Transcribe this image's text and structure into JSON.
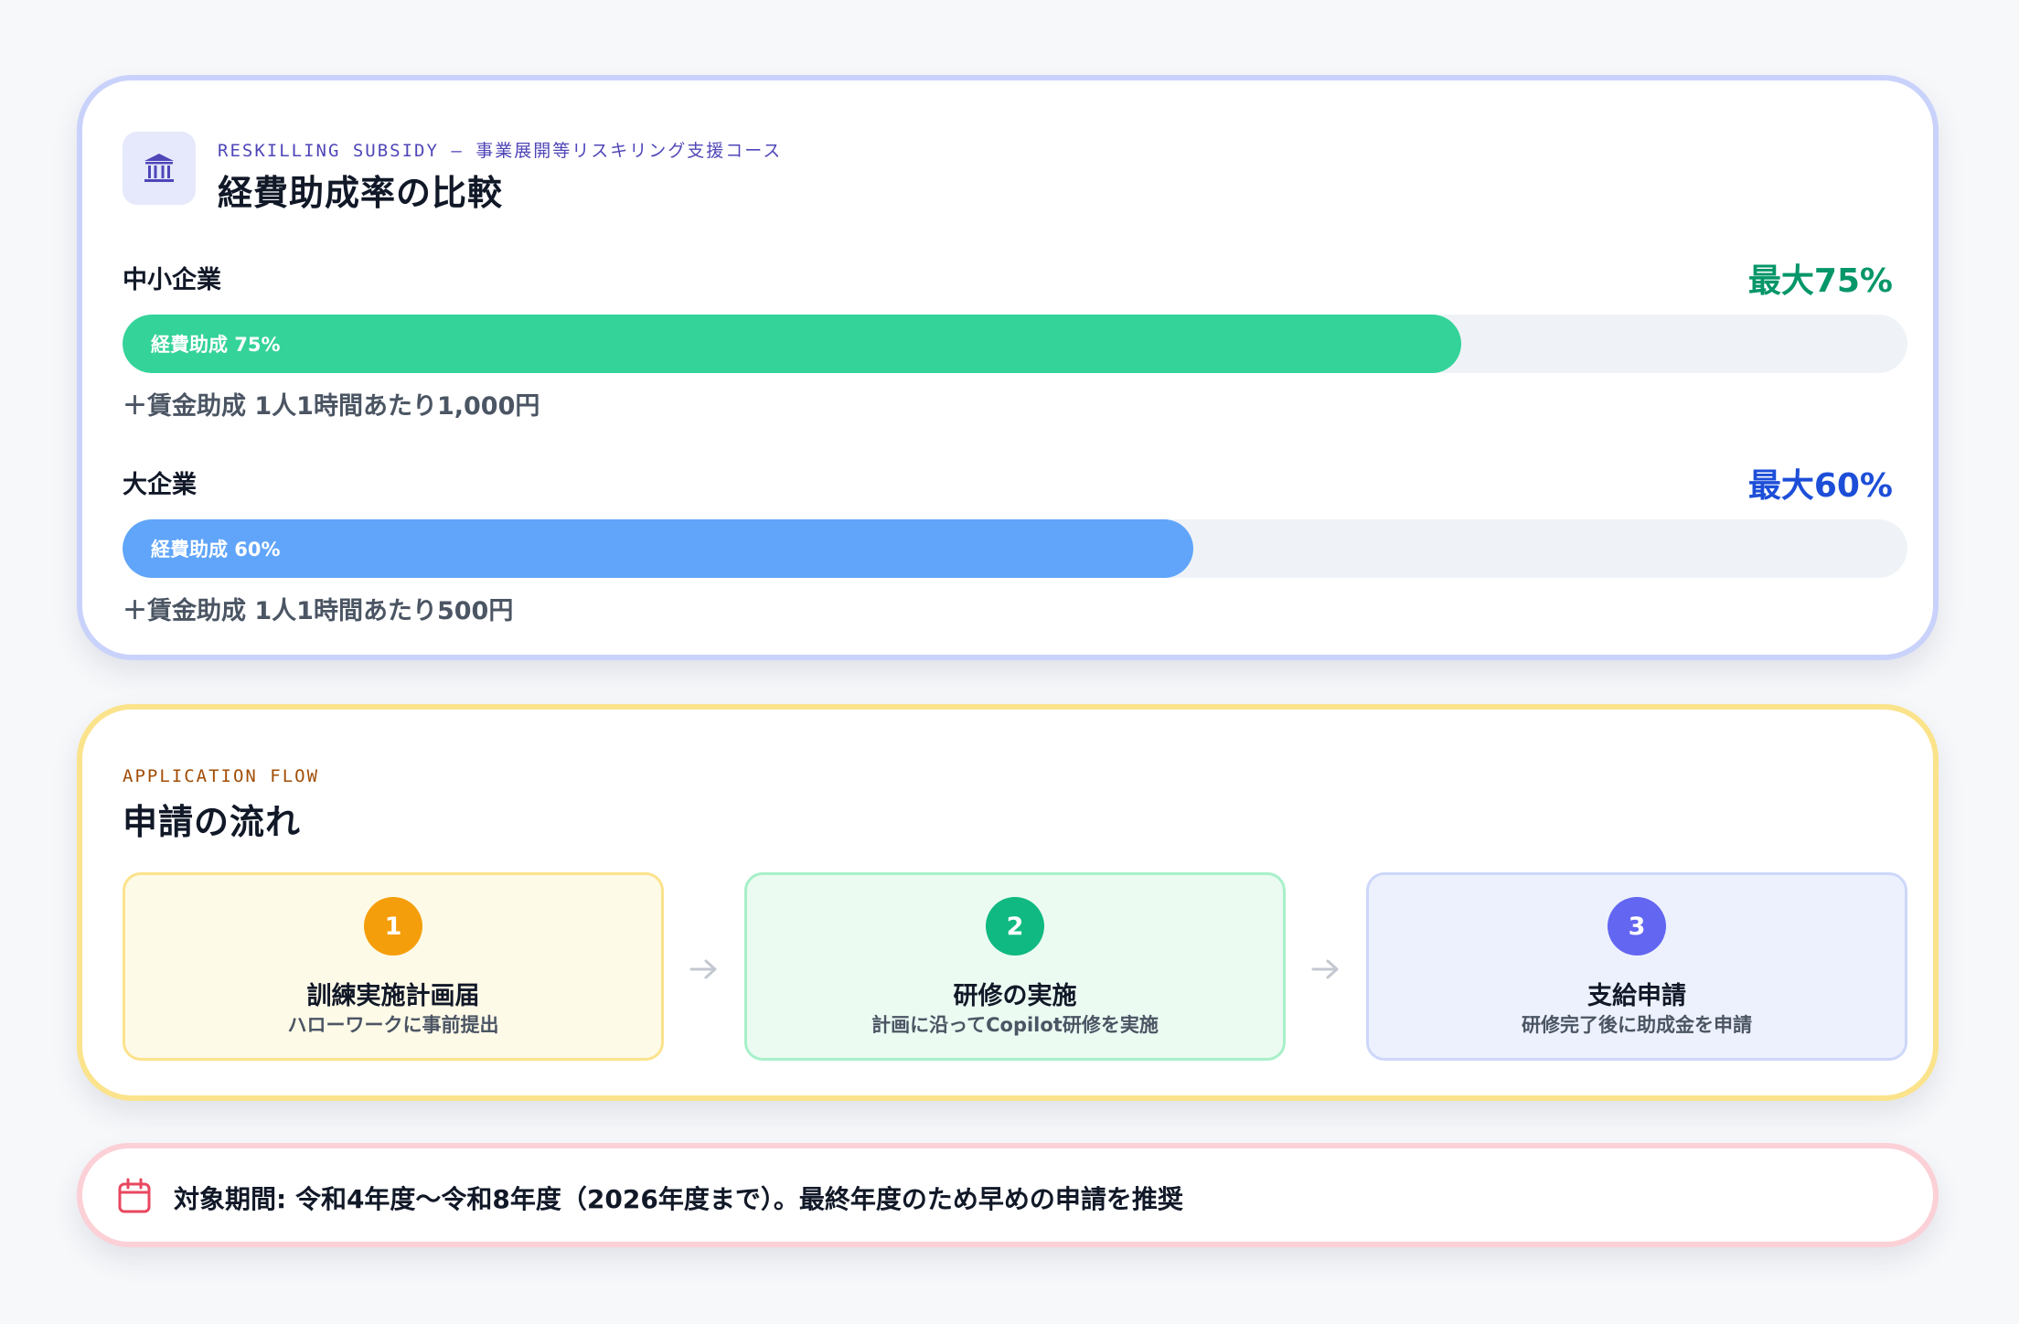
{
  "rates_card": {
    "icon": "bank-icon",
    "eyebrow": "RESKILLING SUBSIDY — 事業展開等リスキリング支援コース",
    "title": "経費助成率の比較",
    "rows": [
      {
        "label": "中小企業",
        "max": "最大75%",
        "bar_text": "経費助成 75%",
        "percent": 75,
        "note": "＋賃金助成 1人1時間あたり1,000円",
        "color": "#34d399",
        "max_color": "#059669"
      },
      {
        "label": "大企業",
        "max": "最大60%",
        "bar_text": "経費助成 60%",
        "percent": 60,
        "note": "＋賃金助成 1人1時間あたり500円",
        "color": "#60a5fa",
        "max_color": "#1d4ed8"
      }
    ]
  },
  "flow_card": {
    "eyebrow": "APPLICATION FLOW",
    "title": "申請の流れ",
    "steps": [
      {
        "num": "1",
        "title": "訓練実施計画届",
        "sub": "ハローワークに事前提出",
        "color": "#f59e0b"
      },
      {
        "num": "2",
        "title": "研修の実施",
        "sub": "計画に沿ってCopilot研修を実施",
        "color": "#10b981"
      },
      {
        "num": "3",
        "title": "支給申請",
        "sub": "研修完了後に助成金を申請",
        "color": "#6366f1"
      }
    ],
    "arrow_icon": "arrow-right-icon"
  },
  "period_card": {
    "icon": "calendar-icon",
    "text": "対象期間: 令和4年度〜令和8年度（2026年度まで）。最終年度のため早めの申請を推奨"
  }
}
